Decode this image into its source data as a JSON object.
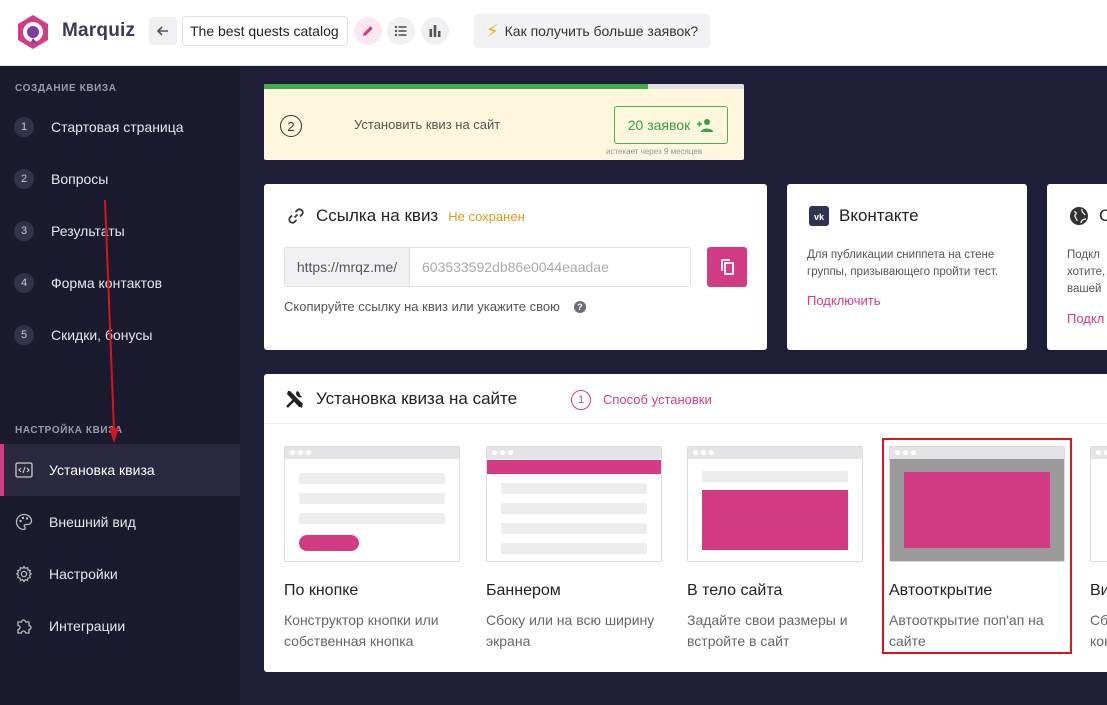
{
  "app": {
    "brand": "Marquiz",
    "quiz_title": "The best quests catalog",
    "help_link": "Как получить больше заявок?"
  },
  "sidebar": {
    "section_create": "СОЗДАНИЕ КВИЗА",
    "steps": [
      {
        "num": "1",
        "label": "Стартовая страница"
      },
      {
        "num": "2",
        "label": "Вопросы"
      },
      {
        "num": "3",
        "label": "Результаты"
      },
      {
        "num": "4",
        "label": "Форма контактов"
      },
      {
        "num": "5",
        "label": "Скидки, бонусы"
      }
    ],
    "section_settings": "НАСТРОЙКА КВИЗА",
    "settings_items": [
      {
        "icon": "code-icon",
        "label": "Установка квиза",
        "active": true
      },
      {
        "icon": "palette-icon",
        "label": "Внешний вид",
        "active": false
      },
      {
        "icon": "gear-icon",
        "label": "Настройки",
        "active": false
      },
      {
        "icon": "puzzle-icon",
        "label": "Интеграции",
        "active": false
      }
    ]
  },
  "notice": {
    "step": "2",
    "text": "Установить квиз на сайт",
    "leads_button": "20 заявок",
    "expires": "истекает через 9 месяцев",
    "progress": 0.8
  },
  "link_card": {
    "title": "Ссылка на квиз",
    "status": "Не сохранен",
    "url_prefix": "https://mrqz.me/",
    "url_value": "603533592db86e0044eaadae",
    "hint": "Скопируйте ссылку на квиз или укажите свою"
  },
  "vk_card": {
    "title": "Вконтакте",
    "desc_line1": "Для публикации сниппета на стене",
    "desc_line2": "группы, призывающего пройти тест.",
    "connect": "Подключить"
  },
  "web_card": {
    "title": "С",
    "desc_line1": "Подкл",
    "desc_line2": "хотите,",
    "desc_line3": "вашей",
    "connect": "Подкл"
  },
  "install": {
    "title": "Установка квиза на сайте",
    "step_num": "1",
    "step_label": "Способ установки",
    "options": [
      {
        "title": "По кнопке",
        "desc_line1": "Конструктор кнопки или",
        "desc_line2": "собственная кнопка"
      },
      {
        "title": "Баннером",
        "desc_line1": "Сбоку или на всю ширину",
        "desc_line2": "экрана"
      },
      {
        "title": "В тело сайта",
        "desc_line1": "Задайте свои размеры и",
        "desc_line2": "встройте в сайт"
      },
      {
        "title": "Автооткрытие",
        "desc_line1": "Автооткрытие поп'ап на",
        "desc_line2": "сайте"
      },
      {
        "title": "Ви",
        "desc_line1": "Сб",
        "desc_line2": "кон"
      }
    ]
  },
  "colors": {
    "accent": "#d33c84",
    "sidebar_bg": "#1b1b2f",
    "main_bg": "#1e1e38",
    "success": "#3fae49",
    "warning": "#e09a1a",
    "highlight": "#e0141e"
  }
}
